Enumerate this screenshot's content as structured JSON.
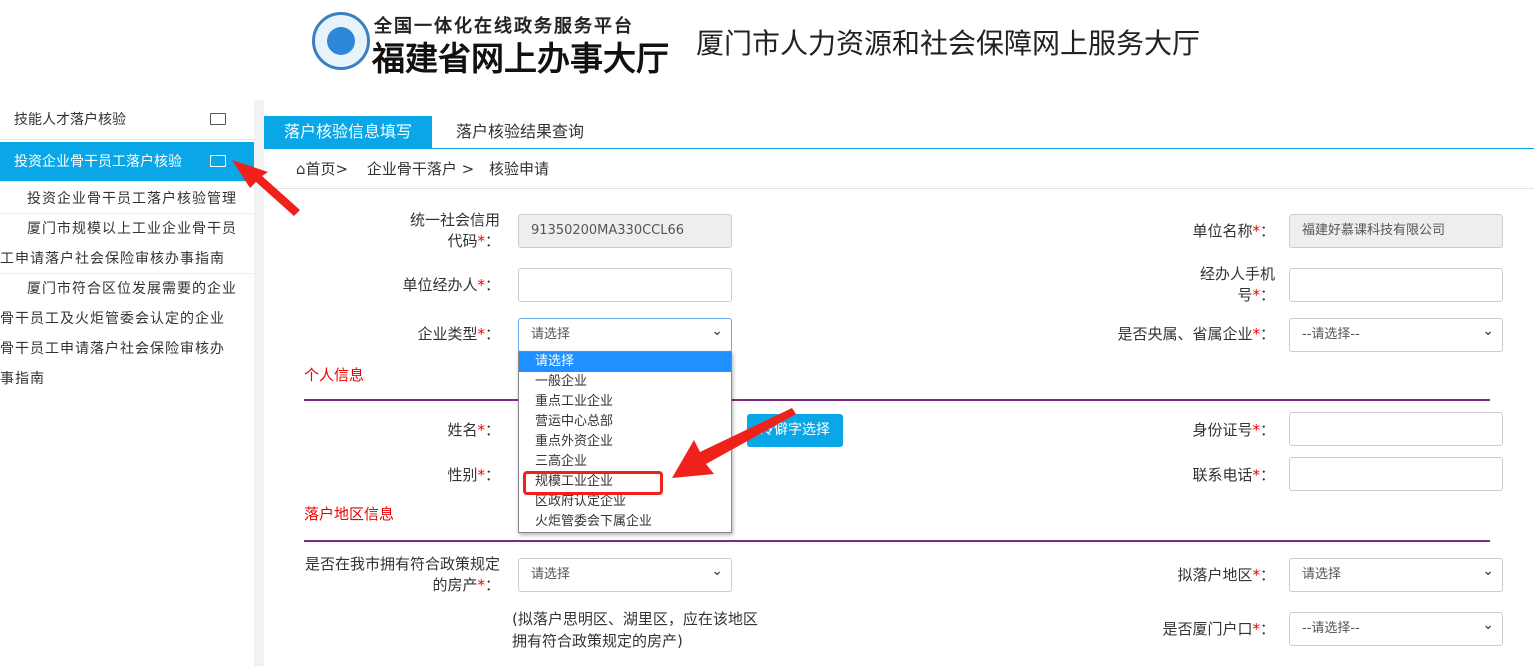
{
  "header": {
    "platform_line": "全国一体化在线政务服务平台",
    "platform_name": "福建省网上办事大厅",
    "site_title": "厦门市人力资源和社会保障网上服务大厅"
  },
  "sidebar": {
    "items": [
      {
        "label": "技能人才落户核验",
        "active": false
      },
      {
        "label": "投资企业骨干员工落户核验",
        "active": true
      }
    ],
    "sub_items": [
      "投资企业骨干员工落户核验管理",
      "厦门市规模以上工业企业骨干员",
      "工申请落户社会保险审核办事指南",
      "厦门市符合区位发展需要的企业",
      "骨干员工及火炬管委会认定的企业",
      "骨干员工申请落户社会保险审核办",
      "事指南"
    ]
  },
  "tabs": [
    {
      "label": "落户核验信息填写",
      "active": true
    },
    {
      "label": "落户核验结果查询",
      "active": false
    }
  ],
  "breadcrumb": {
    "home": "首页>",
    "level1": "企业骨干落户 >",
    "level2": "核验申请"
  },
  "form": {
    "credit_code_label": "统一社会信用代码",
    "credit_code": "91350200MA330CCL66",
    "unit_name_label": "单位名称",
    "unit_name": "福建好慕课科技有限公司",
    "handler_label": "单位经办人",
    "handler": "",
    "handler_phone_label": "经办人手机号",
    "handler_phone": "",
    "enterprise_type_label": "企业类型",
    "enterprise_type": "请选择",
    "central_label": "是否央属、省属企业",
    "central": "--请选择--",
    "personal_section": "个人信息",
    "name_label": "姓名",
    "rare_char_button": "冷僻字选择",
    "id_label": "身份证号",
    "gender_label": "性别",
    "phone_label": "联系电话",
    "area_section": "落户地区信息",
    "house_label": "是否在我市拥有符合政策规定的房产",
    "house": "请选择",
    "house_note": "(拟落户思明区、湖里区，应在该地区拥有符合政策规定的房产)",
    "target_area_label": "拟落户地区",
    "target_area": "请选择",
    "xiamen_hukou_label": "是否厦门户口",
    "xiamen_hukou": "--请选择--",
    "required_mark": "*",
    "colon": "："
  },
  "enterprise_type_options": [
    "请选择",
    "一般企业",
    "重点工业企业",
    "营运中心总部",
    "重点外资企业",
    "三高企业",
    "规模工业企业",
    "区政府认定企业",
    "火炬管委会下属企业"
  ],
  "highlighted_option": "规模工业企业",
  "colors": {
    "accent": "#0aa7e8",
    "section": "#e00000",
    "divider": "#7a2c80",
    "annotation": "#f0201a"
  }
}
